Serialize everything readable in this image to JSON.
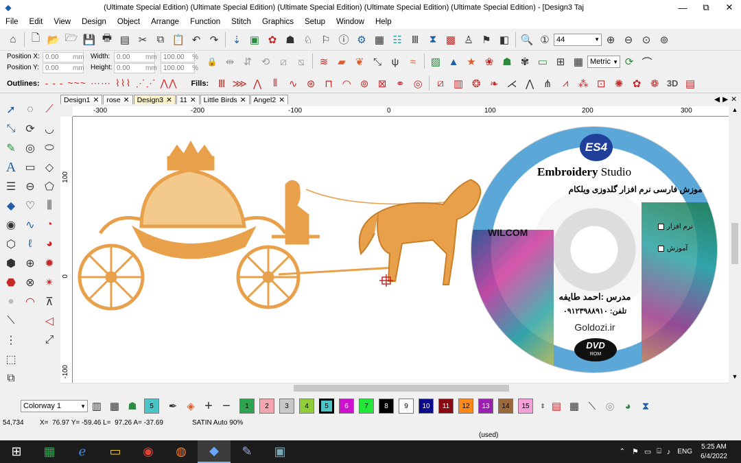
{
  "window": {
    "title": "(Ultimate Special Edition) (Ultimate Special Edition) (Ultimate Special Edition) (Ultimate Special Edition) (Ultimate Special Edition) - [Design3        Taj",
    "min": "—",
    "max": "⧉",
    "close": "✕"
  },
  "menu": [
    "File",
    "Edit",
    "View",
    "Design",
    "Object",
    "Arrange",
    "Function",
    "Stitch",
    "Graphics",
    "Setup",
    "Window",
    "Help"
  ],
  "toolbar": {
    "zoom_value": "44",
    "units_value": "Metric"
  },
  "position": {
    "x_label": "Position X:",
    "y_label": "Position Y:",
    "x_value": "0.00",
    "y_value": "0.00",
    "unit": "mm",
    "width_label": "Width:",
    "height_label": "Height:",
    "width_value": "0.00",
    "height_value": "0.00",
    "wpct": "100.00",
    "hpct": "100.00",
    "pct": "%"
  },
  "labels": {
    "outlines": "Outlines:",
    "fills": "Fills:"
  },
  "tabs": [
    "Design1",
    "rose",
    "Design3",
    "11",
    "Little Birds",
    "Angel2"
  ],
  "active_tab": "Design3",
  "ruler_top": [
    "-300",
    "-200",
    "-100",
    "0",
    "100",
    "200",
    "300"
  ],
  "ruler_left": [
    "100",
    "0",
    "-100"
  ],
  "dvd": {
    "badge": "ES4",
    "brand1": "Embroidery",
    "brand2": "Studio",
    "persian_title": "آموزش فارسی نرم افزار گلدوزی ویلکام",
    "wilcom": "WILCOM",
    "opt1": "نرم افزار",
    "opt2": "آموزش",
    "teacher": "مدرس :احمد طایفه",
    "phone": "تلفن: ۰۹۱۲۳۹۸۸۹۱۰",
    "site": "Goldozi.ir",
    "dvd": "DVD",
    "rom": "ROM"
  },
  "colorway": {
    "label": "Colorway 1",
    "swatches": [
      {
        "n": "5",
        "c": "#4cc3c7",
        "sel": false
      },
      {
        "n": "1",
        "c": "#2ea44f",
        "sel": false
      },
      {
        "n": "2",
        "c": "#f4a6b0",
        "sel": false
      },
      {
        "n": "3",
        "c": "#c8c8c8",
        "sel": false
      },
      {
        "n": "4",
        "c": "#8fce3a",
        "sel": false
      },
      {
        "n": "5",
        "c": "#4cc3c7",
        "sel": true
      },
      {
        "n": "6",
        "c": "#d010d0",
        "sel": false
      },
      {
        "n": "7",
        "c": "#22e83a",
        "sel": false
      },
      {
        "n": "8",
        "c": "#000000",
        "sel": false
      },
      {
        "n": "9",
        "c": "#ffffff",
        "sel": false
      },
      {
        "n": "10",
        "c": "#0a0a8a",
        "sel": false
      },
      {
        "n": "11",
        "c": "#8a0a14",
        "sel": false
      },
      {
        "n": "12",
        "c": "#ff8a1a",
        "sel": false
      },
      {
        "n": "13",
        "c": "#9a20b0",
        "sel": false
      },
      {
        "n": "14",
        "c": "#9c6a3a",
        "sel": false
      },
      {
        "n": "15",
        "c": "#f4a0d8",
        "sel": false
      }
    ]
  },
  "status": {
    "coords": "54,734",
    "xyl": "X=  76.97 Y= -59.46 L=  97.26 A= -37.69",
    "stitch": "SATIN Auto 90%",
    "used": "(used)"
  },
  "taskbar": {
    "lang": "ENG",
    "time": "5:25 AM",
    "date": "6/4/2022"
  },
  "colors": {
    "embroidery": "#e8a04a",
    "embroidery_dark": "#c97f28",
    "accent": "#1f5fa8"
  }
}
